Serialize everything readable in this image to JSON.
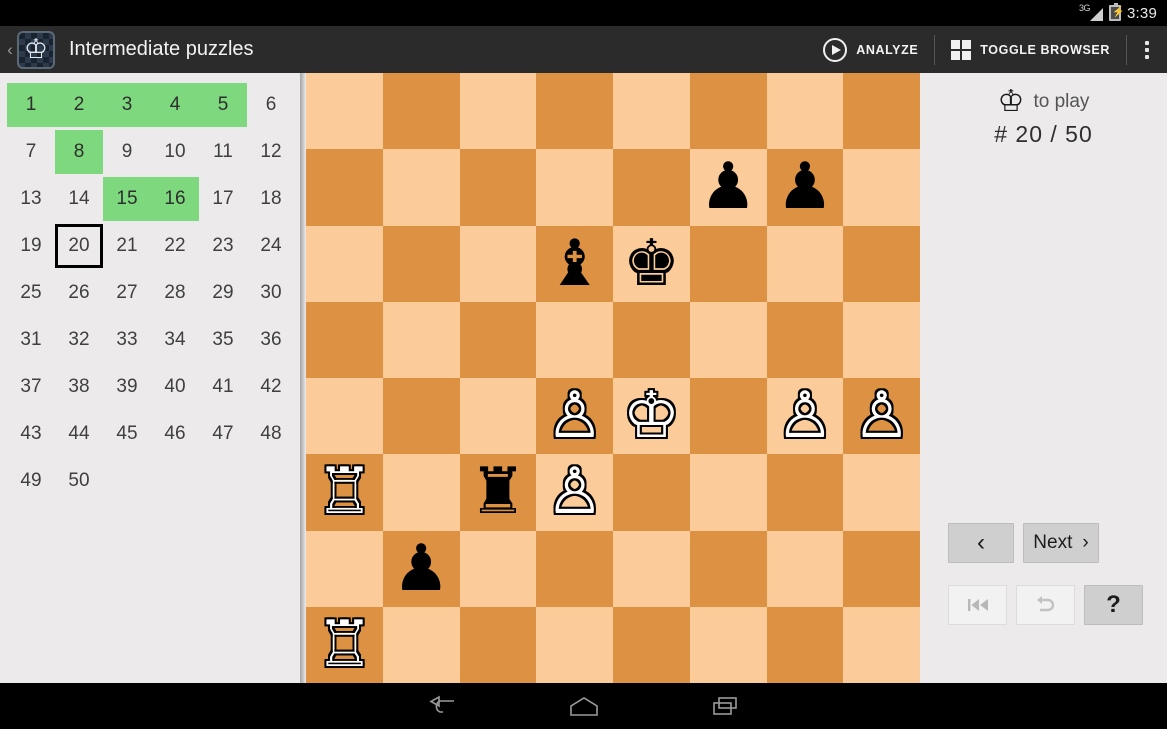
{
  "status_bar": {
    "network": "3G",
    "network_icon": "signal-3g-icon",
    "battery_icon": "battery-charging-icon",
    "time": "3:39"
  },
  "action_bar": {
    "back_caret": "‹",
    "app_icon": "chess-king-app-icon",
    "title": "Intermediate puzzles",
    "analyze_label": "ANALYZE",
    "analyze_icon": "play-circle-icon",
    "toggle_browser_label": "TOGGLE BROWSER",
    "toggle_browser_icon": "grid-4-squares-icon",
    "overflow_icon": "overflow-menu-icon"
  },
  "puzzle_index": {
    "current": 20,
    "cells": [
      {
        "n": "1",
        "state": "done"
      },
      {
        "n": "2",
        "state": "done"
      },
      {
        "n": "3",
        "state": "done"
      },
      {
        "n": "4",
        "state": "done"
      },
      {
        "n": "5",
        "state": "done"
      },
      {
        "n": "6",
        "state": "none"
      },
      {
        "n": "7",
        "state": "none"
      },
      {
        "n": "8",
        "state": "done"
      },
      {
        "n": "9",
        "state": "none"
      },
      {
        "n": "10",
        "state": "none"
      },
      {
        "n": "11",
        "state": "none"
      },
      {
        "n": "12",
        "state": "none"
      },
      {
        "n": "13",
        "state": "none"
      },
      {
        "n": "14",
        "state": "none"
      },
      {
        "n": "15",
        "state": "done"
      },
      {
        "n": "16",
        "state": "done"
      },
      {
        "n": "17",
        "state": "none"
      },
      {
        "n": "18",
        "state": "none"
      },
      {
        "n": "19",
        "state": "none"
      },
      {
        "n": "20",
        "state": "current"
      },
      {
        "n": "21",
        "state": "none"
      },
      {
        "n": "22",
        "state": "none"
      },
      {
        "n": "23",
        "state": "none"
      },
      {
        "n": "24",
        "state": "none"
      },
      {
        "n": "25",
        "state": "none"
      },
      {
        "n": "26",
        "state": "none"
      },
      {
        "n": "27",
        "state": "none"
      },
      {
        "n": "28",
        "state": "none"
      },
      {
        "n": "29",
        "state": "none"
      },
      {
        "n": "30",
        "state": "none"
      },
      {
        "n": "31",
        "state": "none"
      },
      {
        "n": "32",
        "state": "none"
      },
      {
        "n": "33",
        "state": "none"
      },
      {
        "n": "34",
        "state": "none"
      },
      {
        "n": "35",
        "state": "none"
      },
      {
        "n": "36",
        "state": "none"
      },
      {
        "n": "37",
        "state": "none"
      },
      {
        "n": "38",
        "state": "none"
      },
      {
        "n": "39",
        "state": "none"
      },
      {
        "n": "40",
        "state": "none"
      },
      {
        "n": "41",
        "state": "none"
      },
      {
        "n": "42",
        "state": "none"
      },
      {
        "n": "43",
        "state": "none"
      },
      {
        "n": "44",
        "state": "none"
      },
      {
        "n": "45",
        "state": "none"
      },
      {
        "n": "46",
        "state": "none"
      },
      {
        "n": "47",
        "state": "none"
      },
      {
        "n": "48",
        "state": "none"
      },
      {
        "n": "49",
        "state": "none"
      },
      {
        "n": "50",
        "state": "none"
      },
      {
        "n": "",
        "state": "blank"
      },
      {
        "n": "",
        "state": "blank"
      },
      {
        "n": "",
        "state": "blank"
      },
      {
        "n": "",
        "state": "blank"
      }
    ]
  },
  "board": {
    "light_color": "#fbcb9a",
    "dark_color": "#dc9242",
    "rows": [
      [
        "",
        "",
        "",
        "",
        "",
        "",
        "",
        ""
      ],
      [
        "",
        "",
        "",
        "",
        "",
        "bp",
        "bp",
        ""
      ],
      [
        "",
        "",
        "",
        "bb",
        "bk",
        "",
        "",
        ""
      ],
      [
        "",
        "",
        "",
        "",
        "",
        "",
        "",
        ""
      ],
      [
        "",
        "",
        "",
        "wp",
        "wk",
        "",
        "wp",
        "wp"
      ],
      [
        "wr",
        "",
        "br",
        "wp",
        "",
        "",
        "",
        ""
      ],
      [
        "",
        "bp",
        "",
        "",
        "",
        "",
        "",
        ""
      ],
      [
        "wr",
        "",
        "",
        "",
        "",
        "",
        "",
        ""
      ]
    ],
    "glyphs": {
      "wk": "♔",
      "wq": "♕",
      "wr": "♖",
      "wb": "♗",
      "wn": "♘",
      "wp": "♙",
      "bk": "♚",
      "bq": "♛",
      "br": "♜",
      "bb": "♝",
      "bn": "♞",
      "bp": "♟"
    }
  },
  "side_panel": {
    "to_play_icon": "white-king-icon",
    "to_play_glyph": "♔",
    "to_play_label": "to play",
    "counter": "# 20 / 50",
    "prev_label": "‹",
    "next_label": "Next",
    "next_chevron": "›",
    "restart_label": "⏮",
    "undo_label": "↶",
    "help_label": "?"
  },
  "nav_bar": {
    "back_icon": "android-back-icon",
    "home_icon": "android-home-icon",
    "recents_icon": "android-recents-icon"
  }
}
